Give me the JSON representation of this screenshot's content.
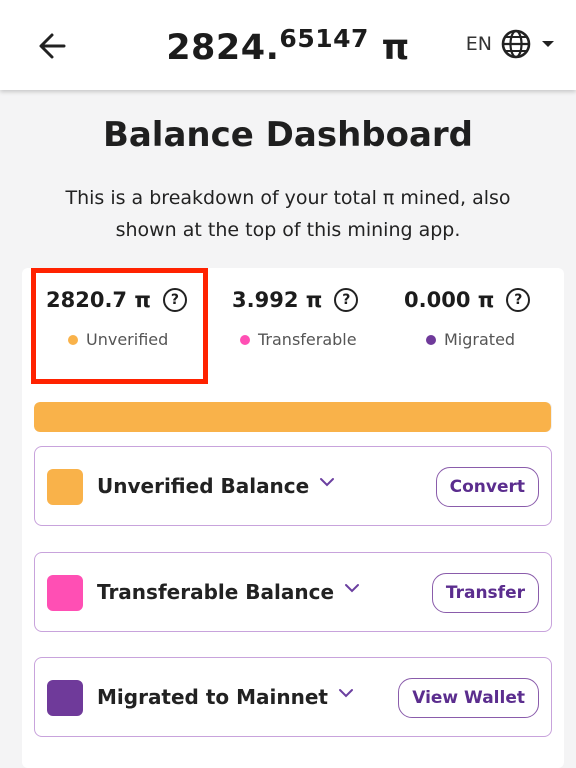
{
  "header": {
    "balance_int": "2824.",
    "balance_dec": "65147",
    "balance_unit": "π",
    "language": "EN"
  },
  "title": "Balance Dashboard",
  "subtitle": "This is a breakdown of your total π mined, also shown at the top of this mining app.",
  "stats": [
    {
      "value": "2820.7 π",
      "label": "Unverified",
      "color": "#f9b24a"
    },
    {
      "value": "3.992 π",
      "label": "Transferable",
      "color": "#ff4fb4"
    },
    {
      "value": "0.000 π",
      "label": "Migrated",
      "color": "#6f3a9a"
    }
  ],
  "help_glyph": "?",
  "progress": {
    "unverified_fraction": 0.9986,
    "color": "#f9b24a"
  },
  "rows": [
    {
      "label": "Unverified Balance",
      "button": "Convert",
      "color": "#f9b24a"
    },
    {
      "label": "Transferable Balance",
      "button": "Transfer",
      "color": "#ff4fb4"
    },
    {
      "label": "Migrated to Mainnet",
      "button": "View Wallet",
      "color": "#6f3a9a"
    }
  ],
  "icons": {
    "back": "arrow-left-icon",
    "globe": "globe-icon",
    "dropdown": "caret-down-icon",
    "expand": "chevron-down-icon"
  }
}
